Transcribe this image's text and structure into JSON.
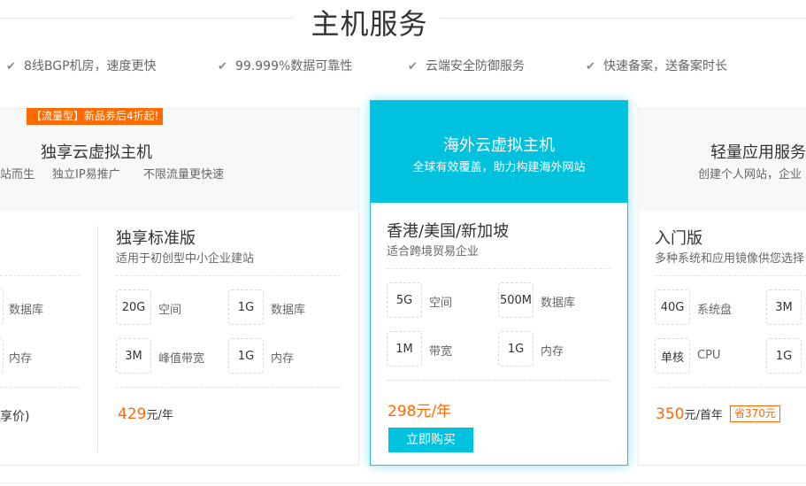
{
  "header": {
    "title": "主机服务"
  },
  "features": [
    {
      "icon": "check-icon",
      "text": "8线BGP机房，速度更快"
    },
    {
      "icon": "check-icon",
      "text": "99.999%数据可靠性"
    },
    {
      "icon": "check-icon",
      "text": "云端安全防御服务"
    },
    {
      "icon": "check-icon",
      "text": "快速备案，送备案时长"
    }
  ],
  "cards": {
    "left": {
      "promo": "【流量型】新品券后4折起!",
      "title": "独享云虚拟主机",
      "subtitle_parts": [
        "站而生",
        "独立IP易推广",
        "不限流量更快速"
      ],
      "plan_prev": {
        "spec_labels": [
          "数据库",
          "内存"
        ],
        "price_tail": "享价)"
      },
      "plan": {
        "name": "独享标准版",
        "desc": "适用于初创型中小企业建站",
        "specs": [
          {
            "value": "20G",
            "label": "空间"
          },
          {
            "value": "1G",
            "label": "数据库"
          },
          {
            "value": "3M",
            "label": "峰值带宽"
          },
          {
            "value": "1G",
            "label": "内存"
          }
        ],
        "price": "429",
        "unit": "元/年"
      }
    },
    "middle": {
      "title": "海外云虚拟主机",
      "subtitle": "全球有效覆盖，助力构建海外网站",
      "plan": {
        "name": "香港/美国/新加坡",
        "desc": "适合跨境贸易企业",
        "specs": [
          {
            "value": "5G",
            "label": "空间"
          },
          {
            "value": "500M",
            "label": "数据库"
          },
          {
            "value": "1M",
            "label": "带宽"
          },
          {
            "value": "1G",
            "label": "内存"
          }
        ],
        "price": "298",
        "unit": "元/年",
        "buy_label": "立即购买"
      }
    },
    "right": {
      "title": "轻量应用服务",
      "subtitle": "创建个人网站，企业",
      "plan": {
        "name": "入门版",
        "desc": "多种系统和应用镜像供您选择",
        "specs": [
          {
            "value": "40G",
            "label": "系统盘"
          },
          {
            "value": "3M",
            "label": ""
          },
          {
            "value": "单核",
            "label": "CPU"
          },
          {
            "value": "1G",
            "label": ""
          }
        ],
        "price": "350",
        "unit": "元/首年",
        "save_badge": "省370元"
      }
    }
  },
  "colors": {
    "accent": "#00c1de",
    "price": "#ff6a00",
    "promo_bg": "#ff6a00"
  }
}
